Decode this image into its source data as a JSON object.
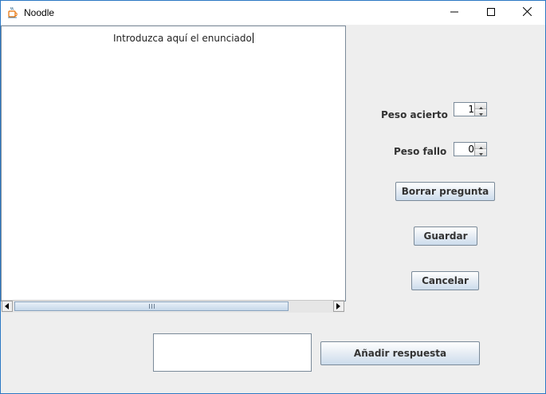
{
  "window": {
    "title": "Noodle",
    "app_icon": "java-cup-icon",
    "controls": [
      "minimize-icon",
      "maximize-icon",
      "close-icon"
    ]
  },
  "editor": {
    "text": "Introduzca aquí el enunciado"
  },
  "form": {
    "peso_acierto_label": "Peso acierto",
    "peso_acierto_value": "1",
    "peso_fallo_label": "Peso fallo",
    "peso_fallo_value": "0"
  },
  "buttons": {
    "borrar": "Borrar pregunta",
    "guardar": "Guardar",
    "cancelar": "Cancelar",
    "anadir": "Añadir respuesta"
  },
  "answer_input": {
    "value": ""
  },
  "colors": {
    "window_border": "#2b78c4",
    "panel_bg": "#eeeeee",
    "button_gradient_bottom": "#ccdcec"
  }
}
